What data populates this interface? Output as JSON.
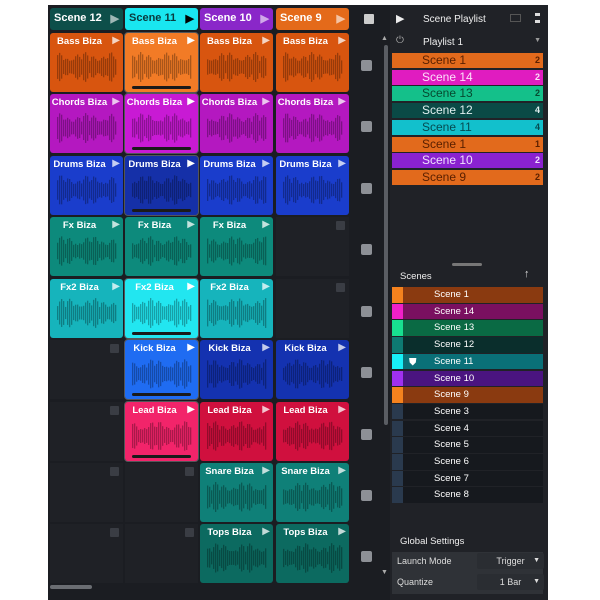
{
  "scene_headers": [
    {
      "label": "Scene 12",
      "color": "#0d4f4a"
    },
    {
      "label": "Scene 11",
      "color": "#19e6f0",
      "selected": true
    },
    {
      "label": "Scene 10",
      "color": "#8a27c9"
    },
    {
      "label": "Scene 9",
      "color": "#e46a1a"
    }
  ],
  "clips": [
    [
      {
        "name": "Bass Biza",
        "color": "#d8550f"
      },
      {
        "name": "Bass Biza",
        "color": "#f27b26",
        "sel": true
      },
      {
        "name": "Bass Biza",
        "color": "#d8550f"
      },
      {
        "name": "Bass Biza",
        "color": "#d8550f"
      }
    ],
    [
      {
        "name": "Chords Biza",
        "color": "#b418c0"
      },
      {
        "name": "Chords Biza",
        "color": "#c81ad4",
        "sel": true
      },
      {
        "name": "Chords Biza",
        "color": "#b418c0"
      },
      {
        "name": "Chords Biza",
        "color": "#b418c0"
      }
    ],
    [
      {
        "name": "Drums Biza",
        "color": "#1a3dcc"
      },
      {
        "name": "Drums Biza",
        "color": "#1530a8",
        "sel": true
      },
      {
        "name": "Drums Biza",
        "color": "#1a3dcc"
      },
      {
        "name": "Drums Biza",
        "color": "#1a3dcc"
      }
    ],
    [
      {
        "name": "Fx Biza",
        "color": "#0d8a7c"
      },
      {
        "name": "Fx Biza",
        "color": "#0d8a7c"
      },
      {
        "name": "Fx Biza",
        "color": "#0d8a7c"
      },
      null
    ],
    [
      {
        "name": "Fx2 Biza",
        "color": "#16b4bc"
      },
      {
        "name": "Fx2 Biza",
        "color": "#22e6f0",
        "sel": true
      },
      {
        "name": "Fx2 Biza",
        "color": "#16b4bc"
      },
      null
    ],
    [
      null,
      {
        "name": "Kick Biza",
        "color": "#1f6cf2",
        "sel": true
      },
      {
        "name": "Kick Biza",
        "color": "#1432b0"
      },
      {
        "name": "Kick Biza",
        "color": "#1432b0"
      }
    ],
    [
      null,
      {
        "name": "Lead Biza",
        "color": "#f2246a",
        "sel": true
      },
      {
        "name": "Lead Biza",
        "color": "#d0103e"
      },
      {
        "name": "Lead Biza",
        "color": "#d0103e"
      }
    ],
    [
      null,
      null,
      {
        "name": "Snare Biza",
        "color": "#0f8078"
      },
      {
        "name": "Snare Biza",
        "color": "#0f8078"
      }
    ],
    [
      null,
      null,
      {
        "name": "Tops Biza",
        "color": "#0c6a60"
      },
      {
        "name": "Tops Biza",
        "color": "#0c6a60"
      }
    ]
  ],
  "playlist_panel": {
    "title": "Scene Playlist",
    "playlist": "Playlist 1",
    "items": [
      {
        "label": "Scene 1",
        "count": "2",
        "color": "#e26a1c",
        "text": "#5a2000"
      },
      {
        "label": "Scene 14",
        "count": "2",
        "color": "#e01cc0",
        "text": "#fde0fa"
      },
      {
        "label": "Scene 13",
        "count": "2",
        "color": "#14c08a",
        "text": "#064a30"
      },
      {
        "label": "Scene 12",
        "count": "4",
        "color": "#0a4a46",
        "text": "#e0f0f0"
      },
      {
        "label": "Scene 11",
        "count": "4",
        "color": "#12c0cc",
        "text": "#064a50"
      },
      {
        "label": "Scene 1",
        "count": "1",
        "color": "#e26a1c",
        "text": "#5a2000"
      },
      {
        "label": "Scene 10",
        "count": "2",
        "color": "#8a22d0",
        "text": "#f0e0ff"
      },
      {
        "label": "Scene 9",
        "count": "2",
        "color": "#e26a1c",
        "text": "#5a2000"
      }
    ]
  },
  "scenes_panel": {
    "title": "Scenes",
    "items": [
      {
        "label": "Scene 1",
        "swatch": "#f5821e",
        "bg": "#8a3a10"
      },
      {
        "label": "Scene 14",
        "swatch": "#f020c8",
        "bg": "#7a1060"
      },
      {
        "label": "Scene 13",
        "swatch": "#18e090",
        "bg": "#0a6a44"
      },
      {
        "label": "Scene 12",
        "swatch": "#0e7a72",
        "bg": "#0a2e2c"
      },
      {
        "label": "Scene 11",
        "swatch": "#18f0f8",
        "bg": "#0a7078",
        "marker": true
      },
      {
        "label": "Scene 10",
        "swatch": "#a030f0",
        "bg": "#4a1480"
      },
      {
        "label": "Scene 9",
        "swatch": "#f5821e",
        "bg": "#8a3a10"
      },
      {
        "label": "Scene 3",
        "swatch": "#2a3a4e",
        "bg": "#16191e"
      },
      {
        "label": "Scene 4",
        "swatch": "#2a3a4e",
        "bg": "#16191e"
      },
      {
        "label": "Scene 5",
        "swatch": "#2a3a4e",
        "bg": "#16191e"
      },
      {
        "label": "Scene 6",
        "swatch": "#2a3a4e",
        "bg": "#16191e"
      },
      {
        "label": "Scene 7",
        "swatch": "#2a3a4e",
        "bg": "#16191e"
      },
      {
        "label": "Scene 8",
        "swatch": "#2a3a4e",
        "bg": "#16191e"
      }
    ]
  },
  "global_settings": {
    "title": "Global Settings",
    "launch_mode_label": "Launch Mode",
    "launch_mode": "Trigger",
    "quantize_label": "Quantize",
    "quantize": "1 Bar"
  },
  "icons": {
    "stop": "stop-icon",
    "play": "play-icon",
    "power": "power-icon",
    "up_arrow": "arrow-up-icon",
    "marker": "location-marker-icon"
  }
}
